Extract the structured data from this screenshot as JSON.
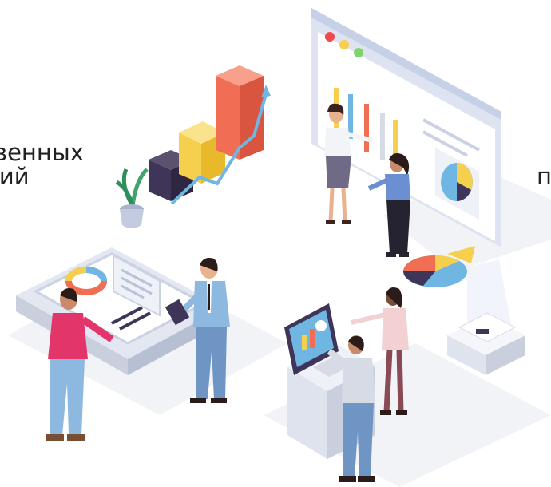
{
  "captions": {
    "left_line_1": "венных",
    "left_line_2": "тий",
    "right_fragment": "п"
  },
  "colors": {
    "background": "#ffffff",
    "text": "#222222",
    "accent_blue": "#6fb6e3",
    "accent_orange": "#f06e54",
    "accent_yellow": "#f7cf4e",
    "accent_purple": "#3f3558",
    "pink_shirt": "#e2356a",
    "jeans_blue": "#8db8e0"
  },
  "icons": [
    "window-dots-icon",
    "bar-chart-icon",
    "pie-chart-icon",
    "growth-arrow-icon",
    "plant-icon"
  ]
}
